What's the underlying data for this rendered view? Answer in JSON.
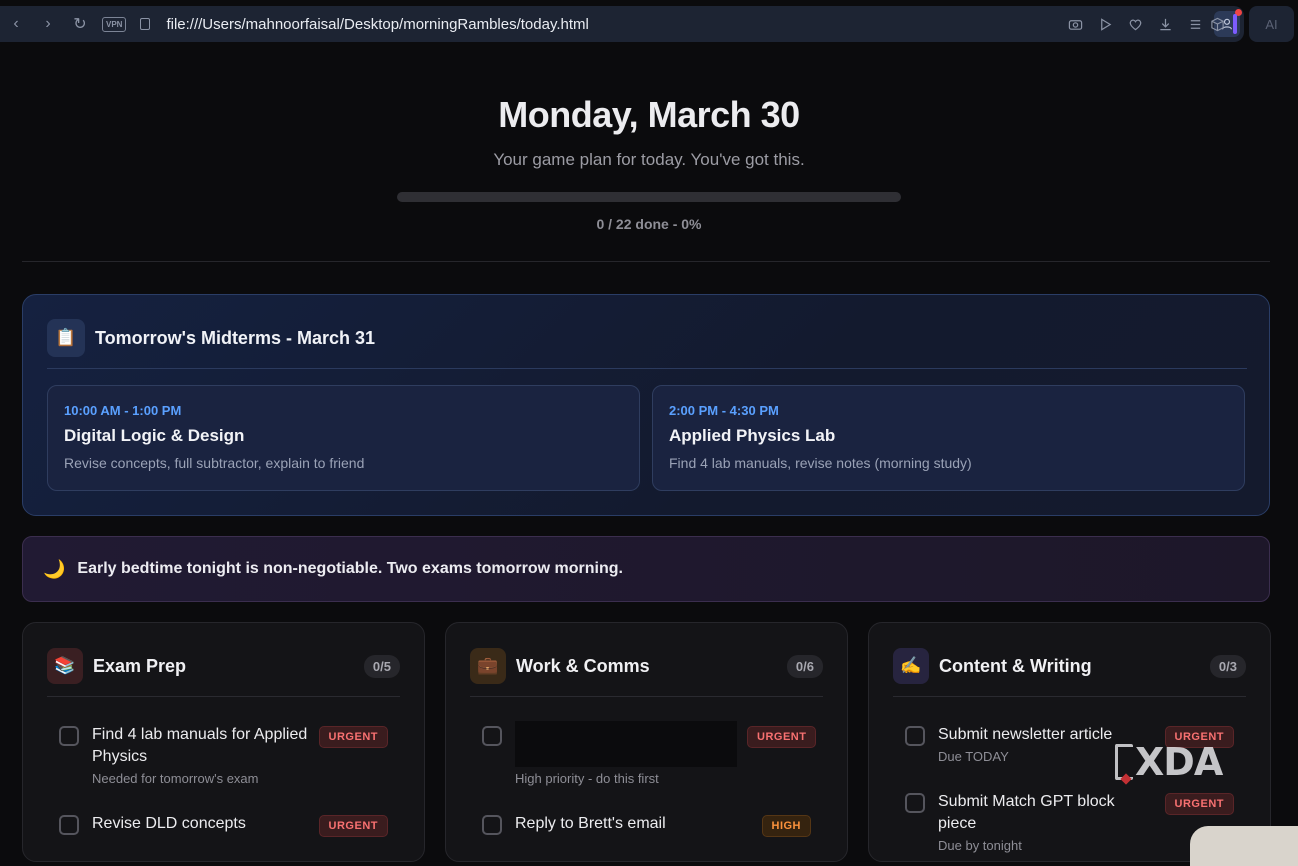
{
  "browser": {
    "url": "file:///Users/mahnoorfaisal/Desktop/morningRambles/today.html",
    "vpn_label": "VPN",
    "ai_label": "AI"
  },
  "header": {
    "date": "Monday, March 30",
    "subtitle": "Your game plan for today. You've got this.",
    "progress_fraction": 0,
    "progress_text": "0 / 22 done - 0%"
  },
  "midterms": {
    "icon": "clipboard-icon",
    "icon_glyph": "📋",
    "title": "Tomorrow's Midterms - March 31",
    "exams": [
      {
        "time": "10:00 AM - 1:00 PM",
        "name": "Digital Logic & Design",
        "desc": "Revise concepts, full subtractor, explain to friend"
      },
      {
        "time": "2:00 PM - 4:30 PM",
        "name": "Applied Physics Lab",
        "desc": "Find 4 lab manuals, revise notes (morning study)"
      }
    ]
  },
  "bedtime": {
    "icon_glyph": "🌙",
    "message": "Early bedtime tonight is non-negotiable. Two exams tomorrow morning."
  },
  "columns": [
    {
      "icon_glyph": "📚",
      "title": "Exam Prep",
      "count": "0/5",
      "tasks": [
        {
          "title": "Find 4 lab manuals for Applied Physics",
          "sub": "Needed for tomorrow's exam",
          "badge": "URGENT"
        },
        {
          "title": "Revise DLD concepts",
          "sub": "",
          "badge": "URGENT"
        }
      ]
    },
    {
      "icon_glyph": "💼",
      "title": "Work & Comms",
      "count": "0/6",
      "tasks": [
        {
          "title": "",
          "sub": "High priority - do this first",
          "badge": "URGENT"
        },
        {
          "title": "Reply to Brett's email",
          "sub": "",
          "badge": "HIGH"
        }
      ]
    },
    {
      "icon_glyph": "✍️",
      "title": "Content & Writing",
      "count": "0/3",
      "tasks": [
        {
          "title": "Submit newsletter article",
          "sub": "Due TODAY",
          "badge": "URGENT"
        },
        {
          "title": "Submit Match GPT block piece",
          "sub": "Due by tonight",
          "badge": "URGENT"
        }
      ]
    }
  ],
  "watermark": "XDA",
  "colors": {
    "accent_blue": "#5aa0ff",
    "urgent": "#f87171",
    "high": "#fb923c"
  }
}
